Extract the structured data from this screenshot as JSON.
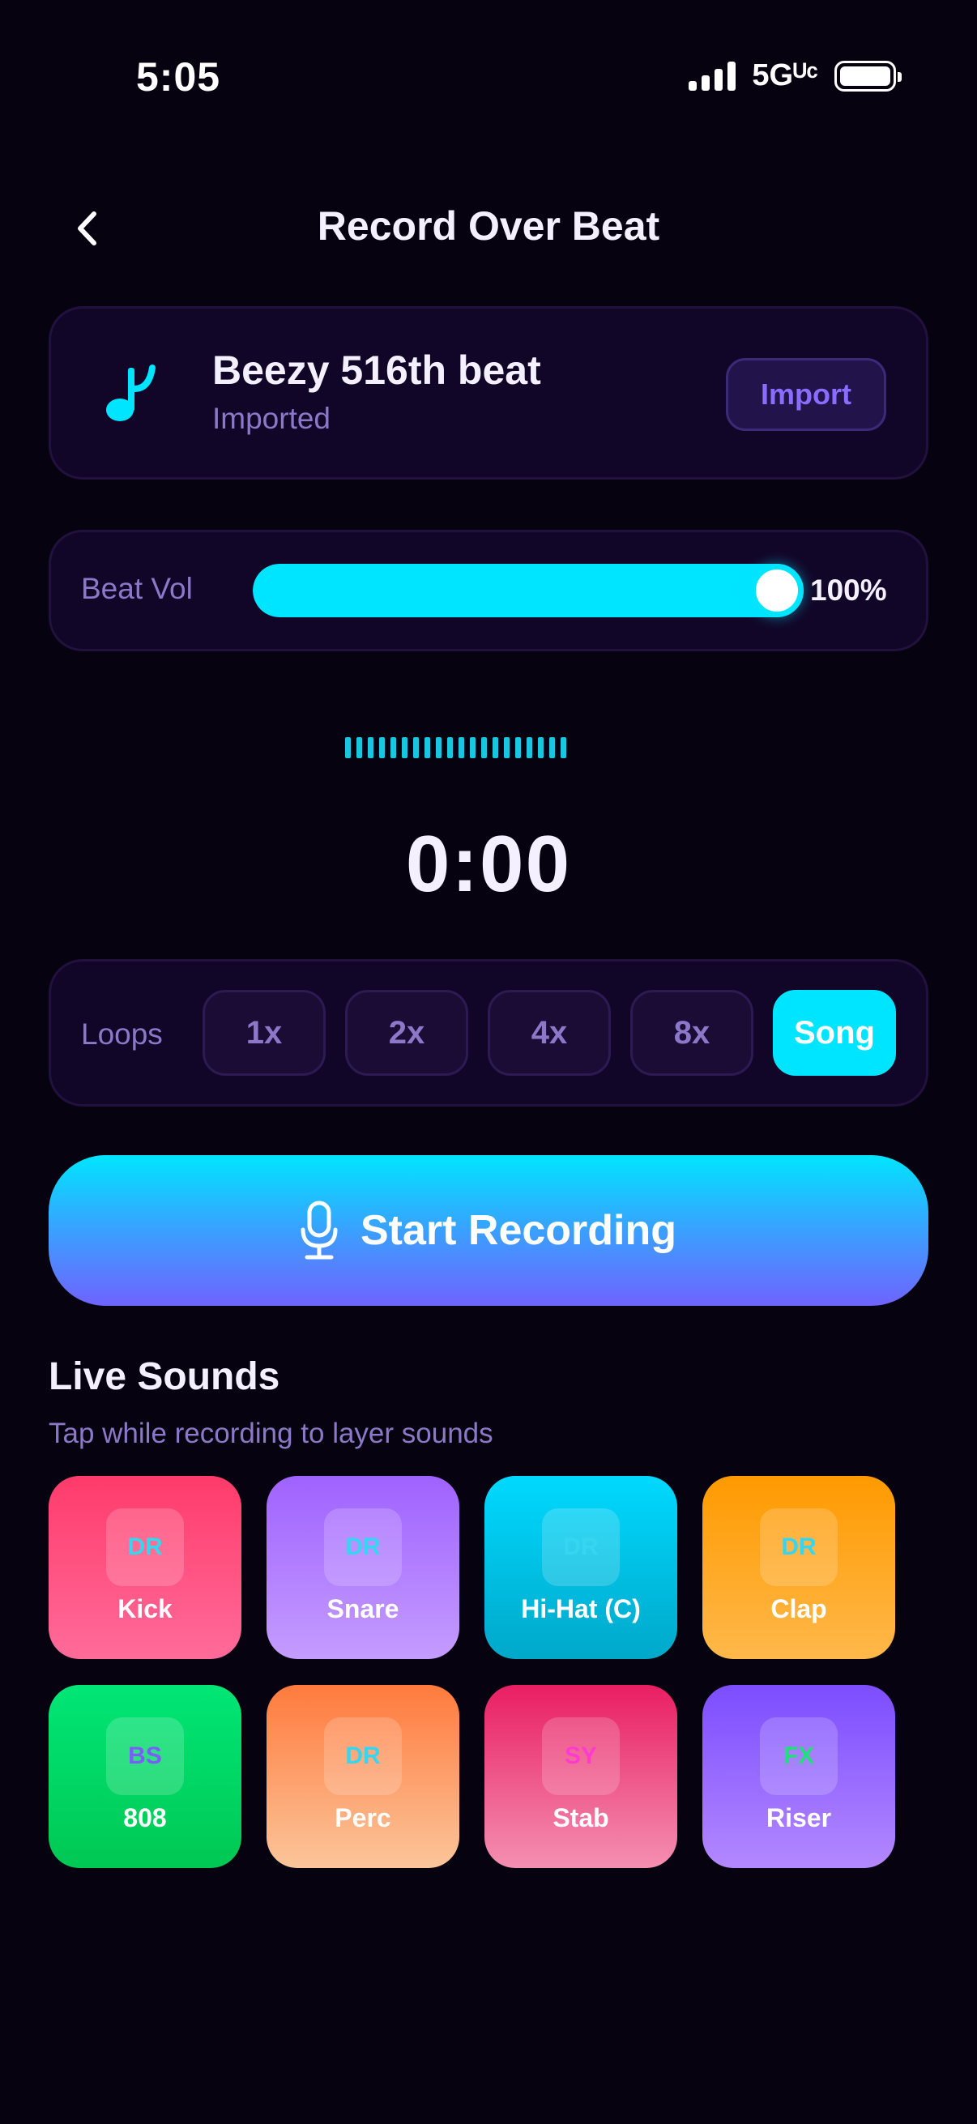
{
  "status": {
    "time": "5:05",
    "network": "5Gᵁᶜ"
  },
  "header": {
    "title": "Record Over Beat",
    "back_icon": "chevron-left-icon"
  },
  "beat": {
    "title": "Beezy 516th beat",
    "subtitle": "Imported",
    "import_label": "Import",
    "icon": "music-note-icon",
    "icon_color": "#00e5ff"
  },
  "volume": {
    "label": "Beat Vol",
    "value_text": "100%",
    "level": 1.0,
    "accent": "#00e5ff"
  },
  "waveform": {
    "bars": 20,
    "color": "#16c7df"
  },
  "timer": {
    "value": "0:00"
  },
  "loops": {
    "label": "Loops",
    "options": [
      "1x",
      "2x",
      "4x",
      "8x",
      "Song"
    ],
    "selected": "Song"
  },
  "record": {
    "label": "Start Recording",
    "icon": "microphone-icon"
  },
  "live_sounds": {
    "title": "Live Sounds",
    "subtitle": "Tap while recording to layer sounds",
    "pads": [
      {
        "label": "Kick",
        "badge": "DR",
        "badge_color": "#36d6f0",
        "gradient": [
          "#ff3b6b",
          "#ff6b9a"
        ]
      },
      {
        "label": "Snare",
        "badge": "DR",
        "badge_color": "#36d6f0",
        "gradient": [
          "#a062ff",
          "#c49cff"
        ]
      },
      {
        "label": "Hi-Hat (C)",
        "badge": "DR",
        "badge_color": "#36d6f0",
        "gradient": [
          "#00d9ff",
          "#00a8c9"
        ]
      },
      {
        "label": "Clap",
        "badge": "DR",
        "badge_color": "#36d6f0",
        "gradient": [
          "#ff9a00",
          "#ffb84a"
        ]
      },
      {
        "label": "808",
        "badge": "BS",
        "badge_color": "#7a5cff",
        "gradient": [
          "#00e676",
          "#00c853"
        ]
      },
      {
        "label": "Perc",
        "badge": "DR",
        "badge_color": "#36d6f0",
        "gradient": [
          "#ff7a3d",
          "#fbc59a"
        ]
      },
      {
        "label": "Stab",
        "badge": "SY",
        "badge_color": "#ff3ad0",
        "gradient": [
          "#e91e63",
          "#f48fb1"
        ]
      },
      {
        "label": "Riser",
        "badge": "FX",
        "badge_color": "#21e07a",
        "gradient": [
          "#7c4dff",
          "#b388ff"
        ]
      }
    ]
  }
}
